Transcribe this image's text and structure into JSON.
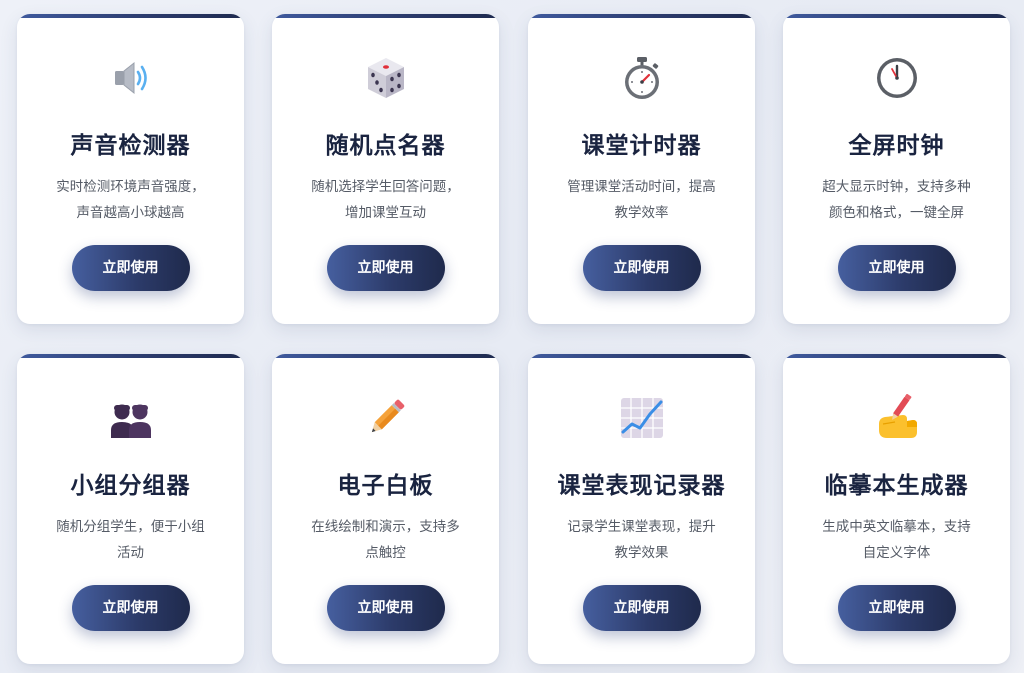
{
  "accent_colors": {
    "button_start": "#465f9f",
    "button_end": "#1f2a4c",
    "title": "#1a2440",
    "desc": "#555b66"
  },
  "tools": [
    {
      "icon": "speaker-icon",
      "title": "声音检测器",
      "desc_line1": "实时检测环境声音强度，",
      "desc_line2": "声音越高小球越高",
      "button": "立即使用"
    },
    {
      "icon": "dice-icon",
      "title": "随机点名器",
      "desc_line1": "随机选择学生回答问题，",
      "desc_line2": "增加课堂互动",
      "button": "立即使用"
    },
    {
      "icon": "stopwatch-icon",
      "title": "课堂计时器",
      "desc_line1": "管理课堂活动时间，提高",
      "desc_line2": "教学效率",
      "button": "立即使用"
    },
    {
      "icon": "clock-icon",
      "title": "全屏时钟",
      "desc_line1": "超大显示时钟，支持多种",
      "desc_line2": "颜色和格式，一键全屏",
      "button": "立即使用"
    },
    {
      "icon": "people-icon",
      "title": "小组分组器",
      "desc_line1": "随机分组学生，便于小组",
      "desc_line2": "活动",
      "button": "立即使用"
    },
    {
      "icon": "pencil-icon",
      "title": "电子白板",
      "desc_line1": "在线绘制和演示，支持多",
      "desc_line2": "点触控",
      "button": "立即使用"
    },
    {
      "icon": "chart-increasing-icon",
      "title": "课堂表现记录器",
      "desc_line1": "记录学生课堂表现，提升",
      "desc_line2": "教学效果",
      "button": "立即使用"
    },
    {
      "icon": "writing-hand-icon",
      "title": "临摹本生成器",
      "desc_line1": "生成中英文临摹本，支持",
      "desc_line2": "自定义字体",
      "button": "立即使用"
    }
  ]
}
